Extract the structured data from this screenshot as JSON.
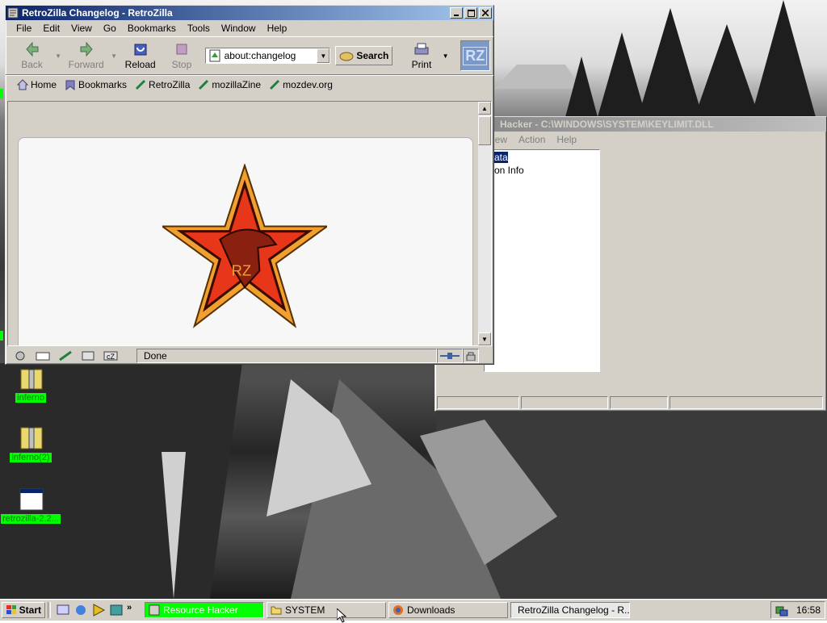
{
  "browser": {
    "title": "RetroZilla Changelog - RetroZilla",
    "menu": [
      "File",
      "Edit",
      "View",
      "Go",
      "Bookmarks",
      "Tools",
      "Window",
      "Help"
    ],
    "nav": {
      "back": "Back",
      "forward": "Forward",
      "reload": "Reload",
      "stop": "Stop",
      "print": "Print"
    },
    "url": "about:changelog",
    "search_label": "Search",
    "logo_text": "RZ",
    "personal": [
      "Home",
      "Bookmarks",
      "RetroZilla",
      "mozillaZine",
      "mozdev.org"
    ],
    "content_logo_text": "RZ",
    "status": "Done"
  },
  "reshacker": {
    "title": "Hacker  -  C:\\WINDOWS\\SYSTEM\\KEYLIMIT.DLL",
    "menu": [
      "iew",
      "Action",
      "Help"
    ],
    "tree": [
      "ata",
      "on Info"
    ]
  },
  "desktop_icons": [
    {
      "label": "inferno"
    },
    {
      "label": "inferno(2)"
    },
    {
      "label": "retrozilla-2.2..."
    }
  ],
  "taskbar": {
    "start": "Start",
    "tasks": [
      "Resource Hacker",
      "SYSTEM",
      "Downloads",
      "RetroZilla Changelog - R..."
    ],
    "clock": "16:58"
  },
  "colors": {
    "accent_green": "#00ff00",
    "title_blue": "#0a246a",
    "star_red": "#e8361a",
    "star_orange": "#f0a030"
  }
}
